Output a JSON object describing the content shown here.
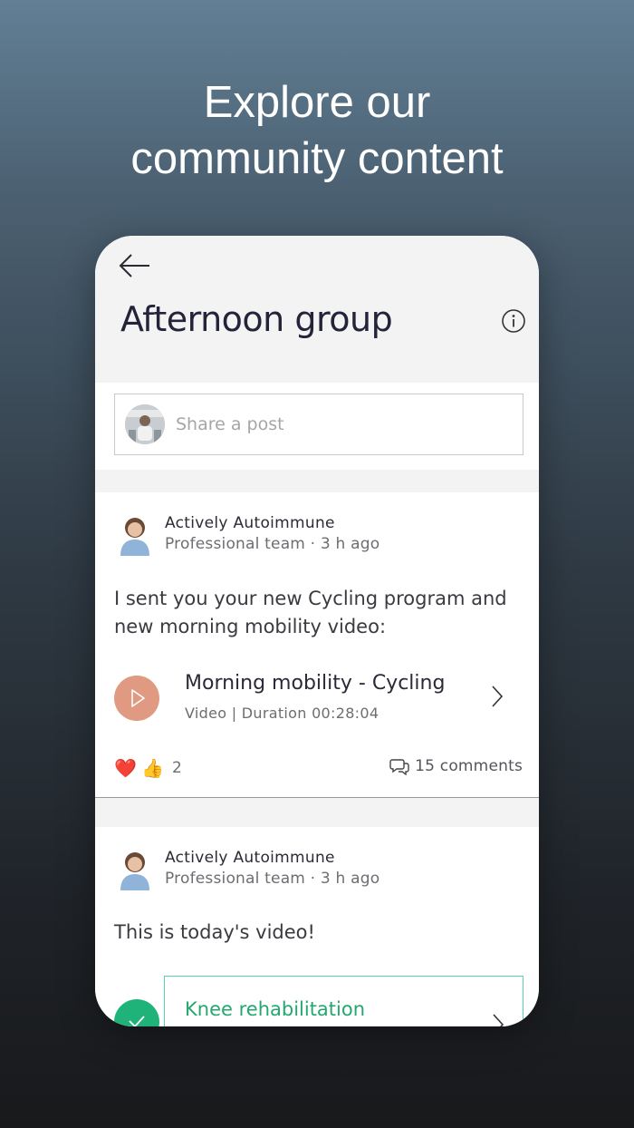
{
  "headline": {
    "line1": "Explore our",
    "line2": "community content"
  },
  "screen": {
    "title": "Afternoon group",
    "share": {
      "placeholder": "Share a post"
    },
    "posts": [
      {
        "author": "Actively Autoimmune",
        "meta": "Professional team · 3 h ago",
        "text": "I sent you your new Cycling program and new morning mobility video:",
        "media": {
          "title": "Morning mobility - Cycling",
          "subtitle": "Video | Duration 00:28:04"
        },
        "reactions": {
          "emojis": [
            "❤️",
            "👍"
          ],
          "count": "2"
        },
        "comments": "15 comments"
      },
      {
        "author": "Actively Autoimmune",
        "meta": "Professional team · 3 h ago",
        "text": "This is today's video!",
        "media": {
          "title": "Knee rehabilitation"
        }
      }
    ]
  },
  "colors": {
    "accent_orange": "#e09a82",
    "accent_green": "#1fb37a",
    "title": "#23233a"
  },
  "icons": [
    "back-arrow-icon",
    "info-icon",
    "play-icon",
    "chevron-right-icon",
    "comment-icon",
    "check-icon"
  ]
}
